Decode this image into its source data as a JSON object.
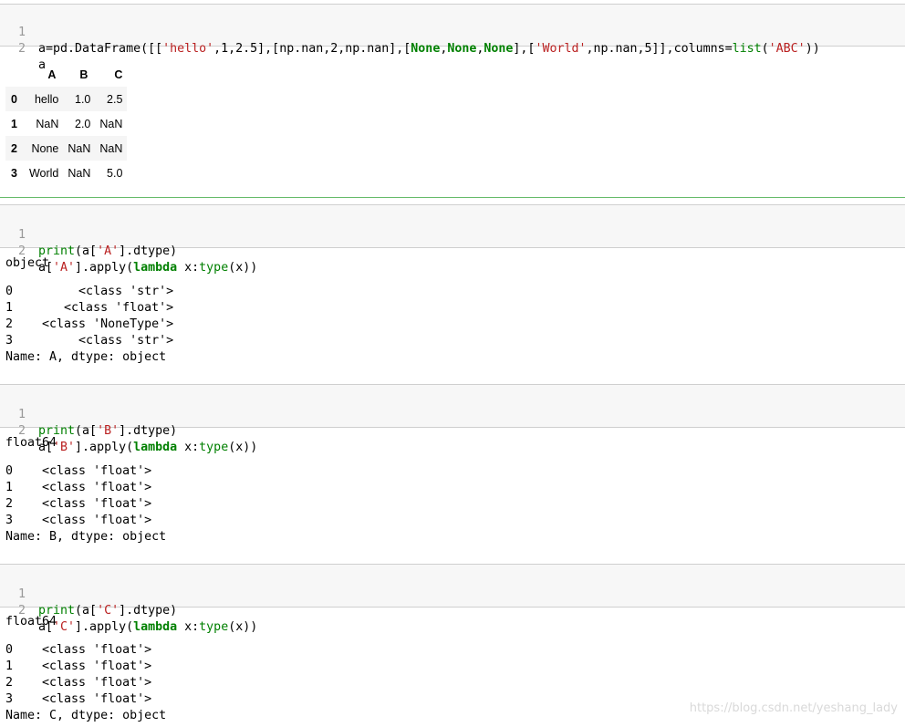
{
  "cells": [
    {
      "lines": [
        {
          "no": "1",
          "tokens": [
            {
              "t": "a=pd.DataFrame([[",
              "c": ""
            },
            {
              "t": "'hello'",
              "c": "str"
            },
            {
              "t": ",1,2.5],[np.nan,2,np.nan],[",
              "c": ""
            },
            {
              "t": "None",
              "c": "kw"
            },
            {
              "t": ",",
              "c": ""
            },
            {
              "t": "None",
              "c": "kw"
            },
            {
              "t": ",",
              "c": ""
            },
            {
              "t": "None",
              "c": "kw"
            },
            {
              "t": "],[",
              "c": ""
            },
            {
              "t": "'World'",
              "c": "str"
            },
            {
              "t": ",np.nan,5]],columns=",
              "c": ""
            },
            {
              "t": "list",
              "c": "bi"
            },
            {
              "t": "(",
              "c": ""
            },
            {
              "t": "'ABC'",
              "c": "str"
            },
            {
              "t": "))",
              "c": ""
            }
          ]
        },
        {
          "no": "2",
          "tokens": [
            {
              "t": "a",
              "c": ""
            }
          ]
        }
      ]
    },
    {
      "lines": [
        {
          "no": "1",
          "tokens": [
            {
              "t": "print",
              "c": "bi"
            },
            {
              "t": "(a[",
              "c": ""
            },
            {
              "t": "'A'",
              "c": "str"
            },
            {
              "t": "].dtype)",
              "c": ""
            }
          ]
        },
        {
          "no": "2",
          "tokens": [
            {
              "t": "a[",
              "c": ""
            },
            {
              "t": "'A'",
              "c": "str"
            },
            {
              "t": "].apply(",
              "c": ""
            },
            {
              "t": "lambda",
              "c": "kw"
            },
            {
              "t": " x:",
              "c": ""
            },
            {
              "t": "type",
              "c": "bi"
            },
            {
              "t": "(x))",
              "c": ""
            }
          ]
        }
      ]
    },
    {
      "lines": [
        {
          "no": "1",
          "tokens": [
            {
              "t": "print",
              "c": "bi"
            },
            {
              "t": "(a[",
              "c": ""
            },
            {
              "t": "'B'",
              "c": "str"
            },
            {
              "t": "].dtype)",
              "c": ""
            }
          ]
        },
        {
          "no": "2",
          "tokens": [
            {
              "t": "a[",
              "c": ""
            },
            {
              "t": "'B'",
              "c": "str"
            },
            {
              "t": "].apply(",
              "c": ""
            },
            {
              "t": "lambda",
              "c": "kw"
            },
            {
              "t": " x:",
              "c": ""
            },
            {
              "t": "type",
              "c": "bi"
            },
            {
              "t": "(x))",
              "c": ""
            }
          ]
        }
      ]
    },
    {
      "lines": [
        {
          "no": "1",
          "tokens": [
            {
              "t": "print",
              "c": "bi"
            },
            {
              "t": "(a[",
              "c": ""
            },
            {
              "t": "'C'",
              "c": "str"
            },
            {
              "t": "].dtype)",
              "c": ""
            }
          ]
        },
        {
          "no": "2",
          "tokens": [
            {
              "t": "a[",
              "c": ""
            },
            {
              "t": "'C'",
              "c": "str"
            },
            {
              "t": "].apply(",
              "c": ""
            },
            {
              "t": "lambda",
              "c": "kw"
            },
            {
              "t": " x:",
              "c": ""
            },
            {
              "t": "type",
              "c": "bi"
            },
            {
              "t": "(x))",
              "c": ""
            }
          ]
        }
      ]
    }
  ],
  "dataframe": {
    "columns": [
      "A",
      "B",
      "C"
    ],
    "rows": [
      {
        "index": "0",
        "values": [
          "hello",
          "1.0",
          "2.5"
        ]
      },
      {
        "index": "1",
        "values": [
          "NaN",
          "2.0",
          "NaN"
        ]
      },
      {
        "index": "2",
        "values": [
          "None",
          "NaN",
          "NaN"
        ]
      },
      {
        "index": "3",
        "values": [
          "World",
          "NaN",
          "5.0"
        ]
      }
    ]
  },
  "outputs": {
    "a": {
      "dtype": "object",
      "lines": [
        "0         <class 'str'>",
        "1       <class 'float'>",
        "2    <class 'NoneType'>",
        "3         <class 'str'>"
      ],
      "footer": "Name: A, dtype: object"
    },
    "b": {
      "dtype": "float64",
      "lines": [
        "0    <class 'float'>",
        "1    <class 'float'>",
        "2    <class 'float'>",
        "3    <class 'float'>"
      ],
      "footer": "Name: B, dtype: object"
    },
    "c": {
      "dtype": "float64",
      "lines": [
        "0    <class 'float'>",
        "1    <class 'float'>",
        "2    <class 'float'>",
        "3    <class 'float'>"
      ],
      "footer": "Name: C, dtype: object"
    }
  },
  "watermark": "https://blog.csdn.net/yeshang_lady",
  "colors": {
    "keyword": "#008000",
    "string": "#ba2121",
    "line_number": "#999999",
    "separator": "#66bb6a"
  }
}
